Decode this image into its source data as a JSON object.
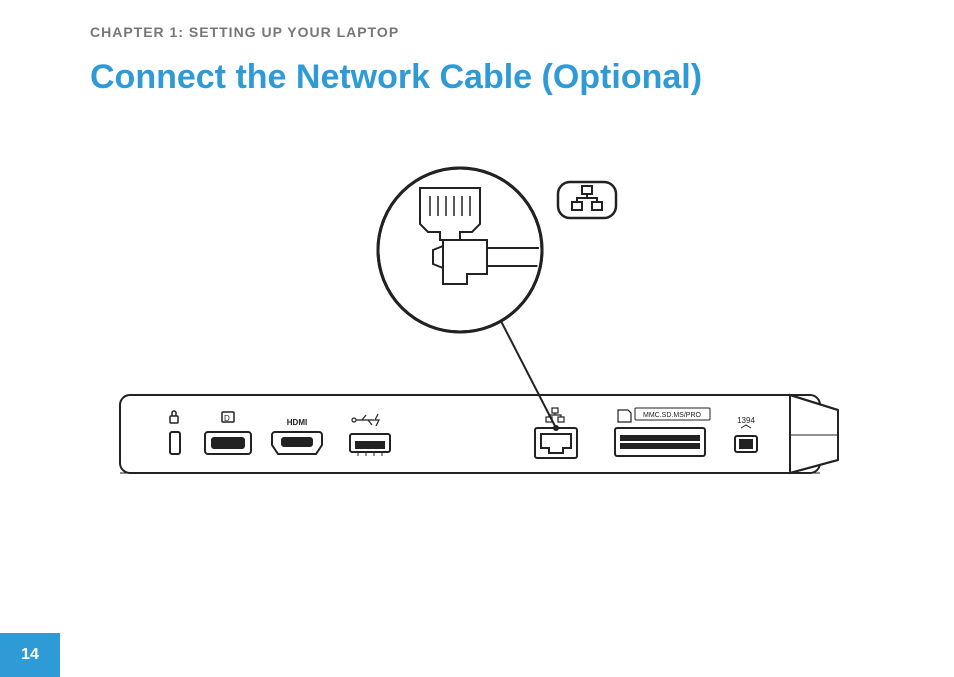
{
  "chapter": "CHAPTER 1: SETTING UP YOUR LAPTOP",
  "heading": "Connect the Network Cable (Optional)",
  "page_number": "14",
  "illustration": {
    "callout_icon": "network-icon",
    "port_labels": {
      "hdmi": "HDMI",
      "card_reader": "MMC.SD.MS/PRO",
      "firewire": "1394"
    }
  }
}
